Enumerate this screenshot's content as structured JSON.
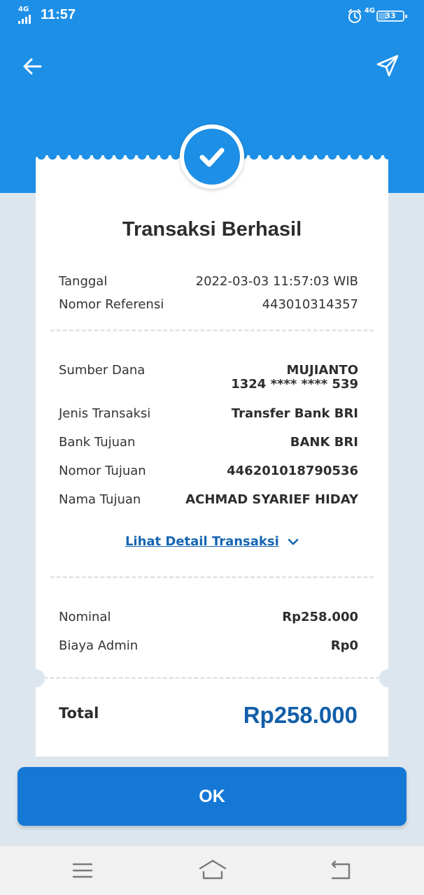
{
  "status_bar": {
    "network_left": "4G",
    "time": "11:57",
    "network_right": "4G",
    "battery": "33"
  },
  "header": {
    "back_icon": "arrow-left-icon",
    "share_icon": "send-icon",
    "color": "#1d8fe6"
  },
  "receipt": {
    "status_icon": "check-icon",
    "title": "Transaksi Berhasil",
    "info": [
      {
        "label": "Tanggal",
        "value": "2022-03-03 11:57:03 WIB"
      },
      {
        "label": "Nomor Referensi",
        "value": "443010314357"
      }
    ],
    "source": {
      "label": "Sumber Dana",
      "name": "MUJIANTO",
      "account": "1324 **** **** 539"
    },
    "details": [
      {
        "label": "Jenis Transaksi",
        "value": "Transfer Bank BRI"
      },
      {
        "label": "Bank Tujuan",
        "value": "BANK BRI"
      },
      {
        "label": "Nomor Tujuan",
        "value": "446201018790536"
      },
      {
        "label": "Nama Tujuan",
        "value": "ACHMAD SYARIEF HIDAY"
      }
    ],
    "detail_link": "Lihat Detail Transaksi",
    "amounts": [
      {
        "label": "Nominal",
        "value": "Rp258.000"
      },
      {
        "label": "Biaya Admin",
        "value": "Rp0"
      }
    ],
    "total_label": "Total",
    "total_value": "Rp258.000",
    "total_color": "#135ea9"
  },
  "ok_button": "OK",
  "nav_bar": {
    "menu_icon": "menu-icon",
    "home_icon": "home-icon",
    "back_icon": "back-icon"
  }
}
